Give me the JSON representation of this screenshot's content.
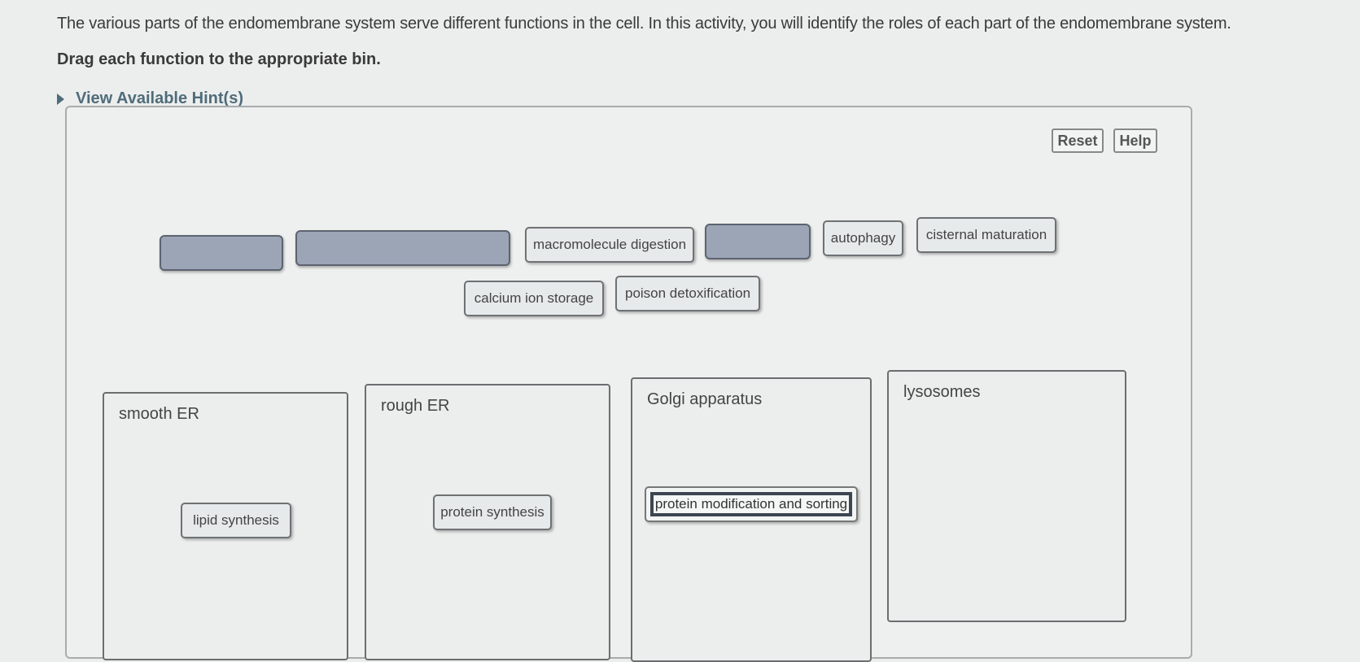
{
  "intro_text": "The various parts of the endomembrane system serve different functions in the cell. In this activity, you will identify the roles of each part of the endomembrane system.",
  "instruction": "Drag each function to the appropriate bin.",
  "hint_link": "View Available Hint(s)",
  "toolbar": {
    "reset_label": "Reset",
    "help_label": "Help"
  },
  "colors": {
    "placeholder_fill": "#9ba5b6",
    "hint_link": "#4f6c7a",
    "cursor": "#e36be0"
  },
  "source_pool": {
    "labels": [
      "macromolecule digestion",
      "autophagy",
      "cisternal maturation",
      "calcium ion storage",
      "poison detoxification"
    ],
    "empty_slots": 3
  },
  "bins": [
    {
      "title": "smooth ER",
      "items": [
        "lipid synthesis"
      ]
    },
    {
      "title": "rough ER",
      "items": [
        "protein synthesis"
      ]
    },
    {
      "title": "Golgi apparatus",
      "items": [
        "protein modification and sorting"
      ]
    },
    {
      "title": "lysosomes",
      "items": []
    }
  ]
}
